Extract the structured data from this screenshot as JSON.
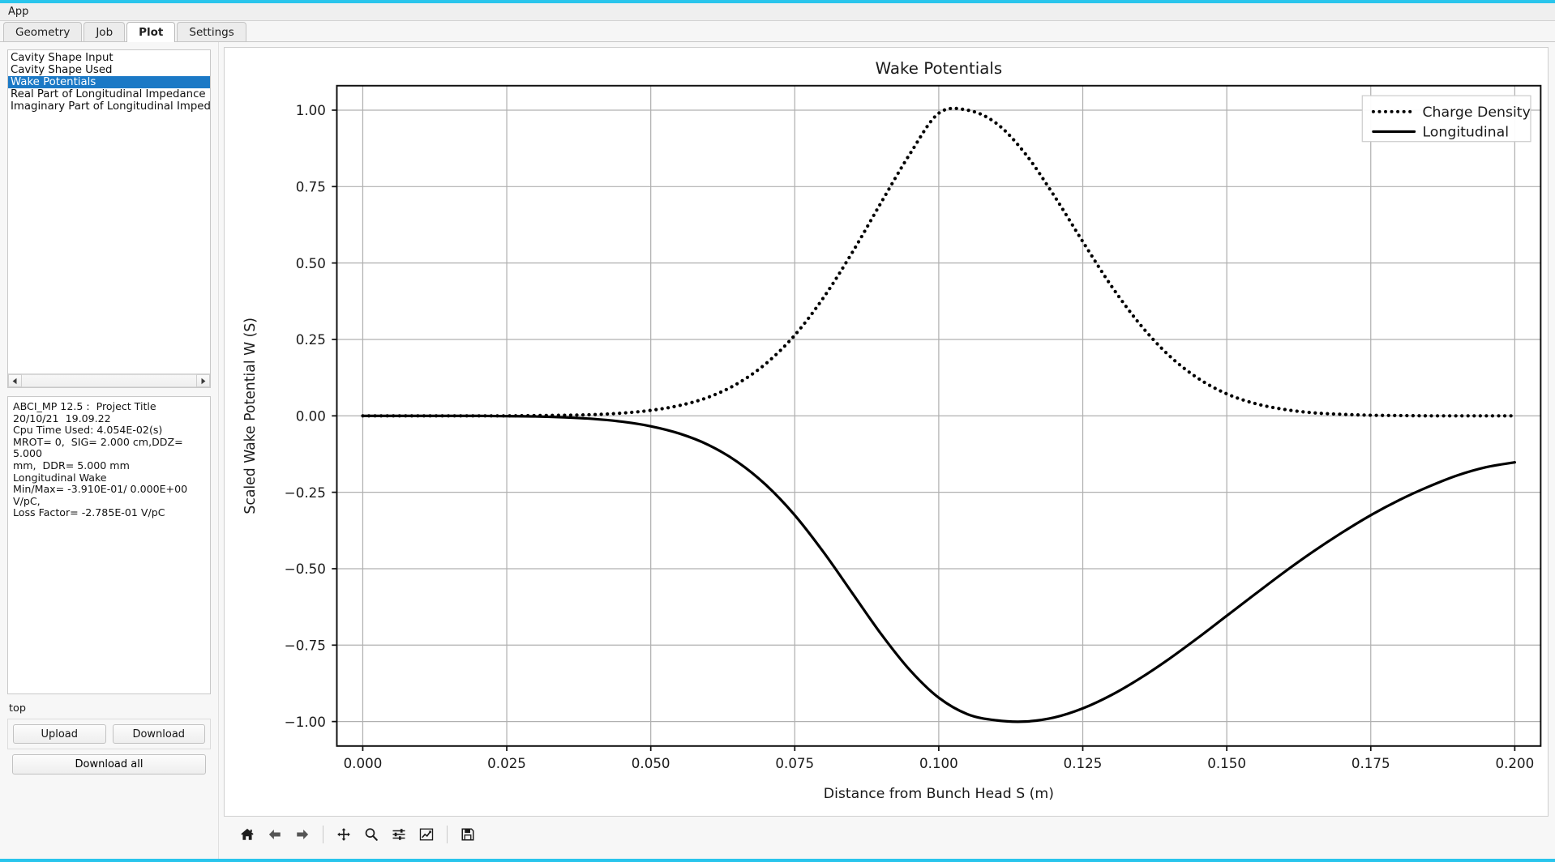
{
  "window": {
    "title": "App",
    "accent_color": "#29c5ec"
  },
  "tabs": [
    {
      "label": "Geometry",
      "active": false
    },
    {
      "label": "Job",
      "active": false
    },
    {
      "label": "Plot",
      "active": true
    },
    {
      "label": "Settings",
      "active": false
    }
  ],
  "sidebar": {
    "plot_list": {
      "items": [
        {
          "label": "Cavity Shape Input",
          "selected": false
        },
        {
          "label": "Cavity Shape Used",
          "selected": false
        },
        {
          "label": "Wake Potentials",
          "selected": true
        },
        {
          "label": "Real Part of Longitudinal Impedance",
          "selected": false
        },
        {
          "label": "Imaginary Part of Longitudinal Impedance",
          "selected": false
        }
      ],
      "selected_color": "#1b79c6"
    },
    "info_lines": [
      "ABCI_MP 12.5 :  Project Title",
      "20/10/21  19.09.22",
      "Cpu Time Used: 4.054E-02(s)",
      "MROT= 0,  SIG= 2.000 cm,DDZ= 5.000",
      "mm,  DDR= 5.000 mm",
      "Longitudinal Wake",
      "Min/Max= -3.910E-01/ 0.000E+00 V/pC,",
      "Loss Factor= -2.785E-01 V/pC"
    ],
    "status_text": "top",
    "buttons": {
      "upload": "Upload",
      "download": "Download",
      "download_all": "Download all"
    }
  },
  "toolbar": {
    "items": [
      {
        "name": "home-icon",
        "tooltip": "Reset original view"
      },
      {
        "name": "arrow-left-icon",
        "tooltip": "Back to previous view"
      },
      {
        "name": "arrow-right-icon",
        "tooltip": "Forward to next view"
      },
      {
        "name": "move-icon",
        "tooltip": "Pan axes with left mouse, zoom with right"
      },
      {
        "name": "magnifier-icon",
        "tooltip": "Zoom to rectangle"
      },
      {
        "name": "sliders-icon",
        "tooltip": "Configure subplots"
      },
      {
        "name": "chart-line-icon",
        "tooltip": "Edit axis, curve and image parameters"
      },
      {
        "name": "floppy-disk-icon",
        "tooltip": "Save the figure"
      }
    ]
  },
  "chart_data": {
    "type": "line",
    "title": "Wake Potentials",
    "xlabel": "Distance from Bunch Head S (m)",
    "ylabel": "Scaled Wake Potential W (S)",
    "xlim": [
      -0.0045,
      0.2045
    ],
    "ylim": [
      -1.08,
      1.08
    ],
    "xticks": [
      0.0,
      0.025,
      0.05,
      0.075,
      0.1,
      0.125,
      0.15,
      0.175,
      0.2
    ],
    "xticklabels": [
      "0.000",
      "0.025",
      "0.050",
      "0.075",
      "0.100",
      "0.125",
      "0.150",
      "0.175",
      "0.200"
    ],
    "yticks": [
      -1.0,
      -0.75,
      -0.5,
      -0.25,
      0.0,
      0.25,
      0.5,
      0.75,
      1.0
    ],
    "yticklabels": [
      "−1.00",
      "−0.75",
      "−0.50",
      "−0.25",
      "0.00",
      "0.25",
      "0.50",
      "0.75",
      "1.00"
    ],
    "grid": true,
    "legend_position": "upper right",
    "series": [
      {
        "name": "Charge Density",
        "linestyle": "dotted",
        "color": "#000000",
        "x": [
          0.0,
          0.005,
          0.01,
          0.015,
          0.02,
          0.025,
          0.03,
          0.035,
          0.04,
          0.045,
          0.05,
          0.055,
          0.06,
          0.065,
          0.07,
          0.075,
          0.08,
          0.085,
          0.09,
          0.095,
          0.1,
          0.105,
          0.11,
          0.115,
          0.12,
          0.125,
          0.13,
          0.135,
          0.14,
          0.145,
          0.15,
          0.155,
          0.16,
          0.165,
          0.17,
          0.175,
          0.18,
          0.185,
          0.19,
          0.195,
          0.2
        ],
        "y": [
          0.0,
          0.0,
          0.0,
          0.0,
          0.0,
          0.0,
          0.001,
          0.002,
          0.004,
          0.009,
          0.018,
          0.034,
          0.061,
          0.105,
          0.171,
          0.264,
          0.387,
          0.535,
          0.698,
          0.857,
          0.99,
          1.0,
          0.957,
          0.858,
          0.721,
          0.57,
          0.424,
          0.298,
          0.197,
          0.123,
          0.072,
          0.04,
          0.021,
          0.01,
          0.005,
          0.002,
          0.001,
          0.0,
          0.0,
          0.0,
          0.0
        ]
      },
      {
        "name": "Longitudinal",
        "linestyle": "solid",
        "color": "#000000",
        "x": [
          0.0,
          0.005,
          0.01,
          0.015,
          0.02,
          0.025,
          0.03,
          0.035,
          0.04,
          0.045,
          0.05,
          0.055,
          0.06,
          0.065,
          0.07,
          0.075,
          0.08,
          0.085,
          0.09,
          0.095,
          0.1,
          0.105,
          0.11,
          0.115,
          0.12,
          0.125,
          0.13,
          0.135,
          0.14,
          0.145,
          0.15,
          0.155,
          0.16,
          0.165,
          0.17,
          0.175,
          0.18,
          0.185,
          0.19,
          0.195,
          0.2
        ],
        "y": [
          0.0,
          0.0,
          0.0,
          0.0,
          0.0,
          -0.001,
          -0.002,
          -0.005,
          -0.01,
          -0.019,
          -0.034,
          -0.058,
          -0.095,
          -0.15,
          -0.226,
          -0.325,
          -0.446,
          -0.58,
          -0.714,
          -0.832,
          -0.922,
          -0.976,
          -0.996,
          -1.0,
          -0.987,
          -0.957,
          -0.913,
          -0.858,
          -0.795,
          -0.726,
          -0.654,
          -0.582,
          -0.511,
          -0.444,
          -0.382,
          -0.325,
          -0.275,
          -0.232,
          -0.195,
          -0.168,
          -0.152
        ]
      }
    ],
    "legend_entries": [
      "Charge Density",
      "Longitudinal"
    ]
  }
}
